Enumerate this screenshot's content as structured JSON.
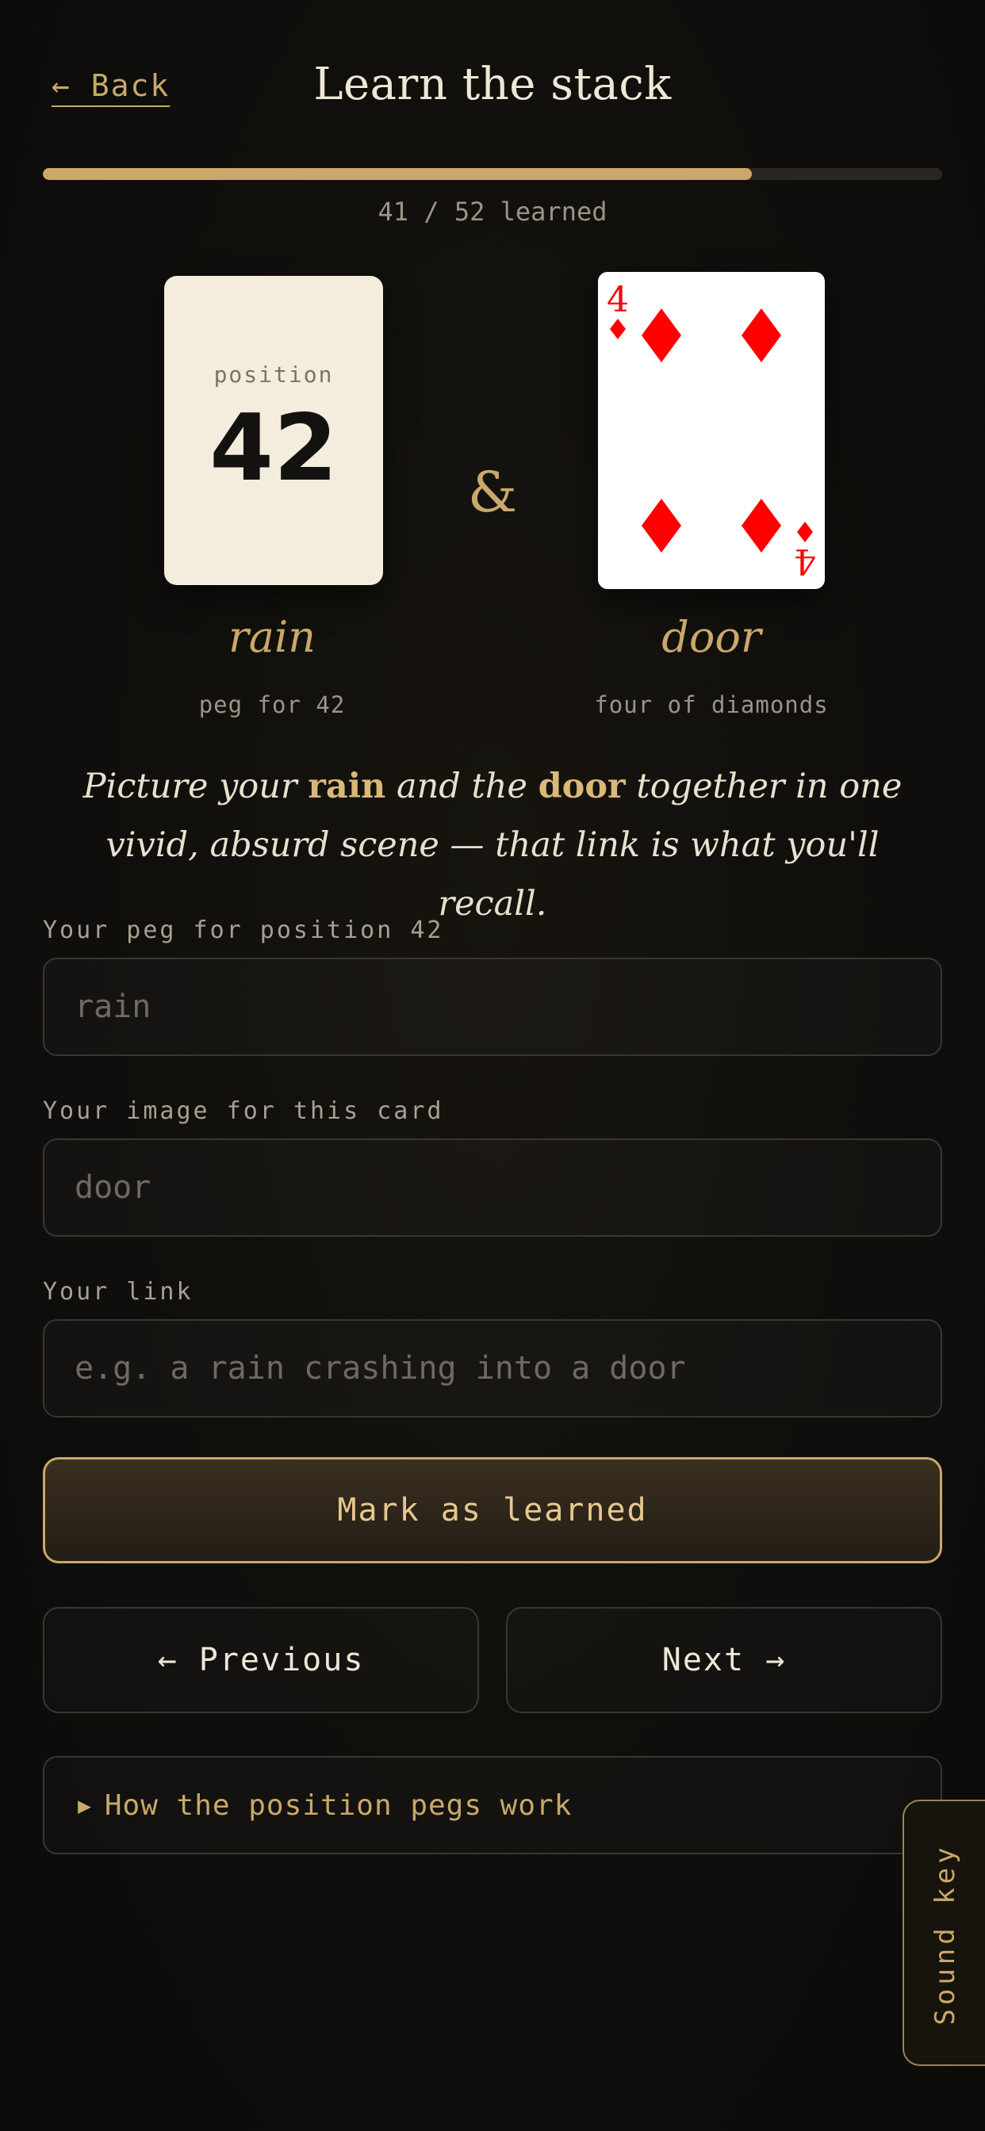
{
  "header": {
    "back_label": "← Back",
    "title": "Learn the stack"
  },
  "progress": {
    "learned": 41,
    "total": 52,
    "fraction": 0.788,
    "text": "41 / 52 learned"
  },
  "position_card": {
    "label": "position",
    "number": "42"
  },
  "ampersand": "&",
  "playing_card": {
    "rank": "4",
    "suit": "diamonds",
    "suit_symbol": "♦",
    "color": "#ff0000"
  },
  "peg": {
    "word": "rain",
    "caption": "peg for 42"
  },
  "card_image": {
    "word": "door",
    "caption": "four of diamonds"
  },
  "instruction": {
    "before": "Picture your ",
    "peg_word": "rain",
    "middle": " and the ",
    "card_word": "door",
    "after": " together in one vivid, absurd scene — that link is what you'll recall."
  },
  "form": {
    "peg_label": "Your peg for position 42",
    "peg_placeholder": "rain",
    "image_label": "Your image for this card",
    "image_placeholder": "door",
    "link_label": "Your link",
    "link_placeholder": "e.g. a rain crashing into a door"
  },
  "actions": {
    "mark_learned": "Mark as learned",
    "previous": "← Previous",
    "next": "Next →"
  },
  "details": {
    "toggle_icon": "▶",
    "label": "How the position pegs work"
  },
  "sound_key": "Sound key",
  "colors": {
    "accent": "#c9a86a",
    "background": "#0f0e0c",
    "card_red": "#ff0000"
  }
}
